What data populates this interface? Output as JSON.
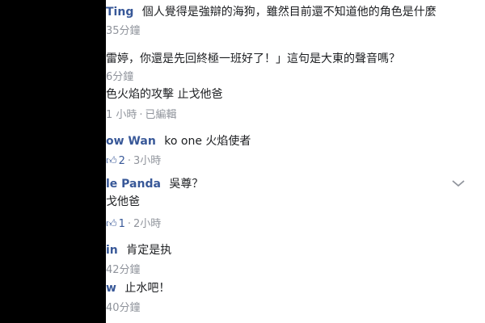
{
  "comments": [
    {
      "name": "Ting",
      "text": "個人覺得是強辯的海狗，雖然目前還不知道他的角色是什麼",
      "time": "35分鐘"
    },
    {
      "text": "雷婷，你還是先回終極一班好了！」這句是大東的聲音嗎？",
      "time": "6分鐘"
    },
    {
      "text": "色火焰的攻擊 止戈他爸",
      "time": "1 小時",
      "edited": "已編輯"
    },
    {
      "name": "ow Wan",
      "text": "ko one 火焰使者",
      "likes": "2",
      "time": "3小時"
    },
    {
      "name": "le Panda",
      "text": "吳尊？",
      "text2": "戈他爸",
      "likes": "1",
      "time": "2小時"
    },
    {
      "name": "in",
      "text": "肯定是执",
      "time": "42分鐘"
    },
    {
      "name": "w",
      "text": "止水吧！",
      "time": "40分鐘"
    }
  ],
  "icons": {
    "like": "thumbs-up-icon",
    "options": "chevron-down-icon"
  },
  "colors": {
    "name": "#385898",
    "meta": "#90949c",
    "text": "#1c1e21"
  }
}
